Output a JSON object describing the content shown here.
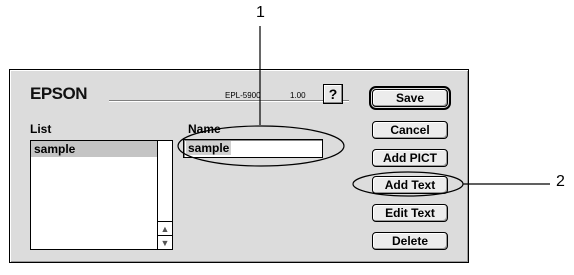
{
  "callouts": {
    "one": "1",
    "two": "2"
  },
  "dialog": {
    "brand": "EPSON",
    "model": "EPL-5900",
    "version": "1.00",
    "help_label": "?",
    "list_label": "List",
    "name_label": "Name",
    "list_items": [
      "sample"
    ],
    "name_value": "sample",
    "buttons": {
      "save": "Save",
      "cancel": "Cancel",
      "add_pict": "Add PICT",
      "add_text": "Add Text",
      "edit_text": "Edit Text",
      "delete": "Delete"
    }
  }
}
